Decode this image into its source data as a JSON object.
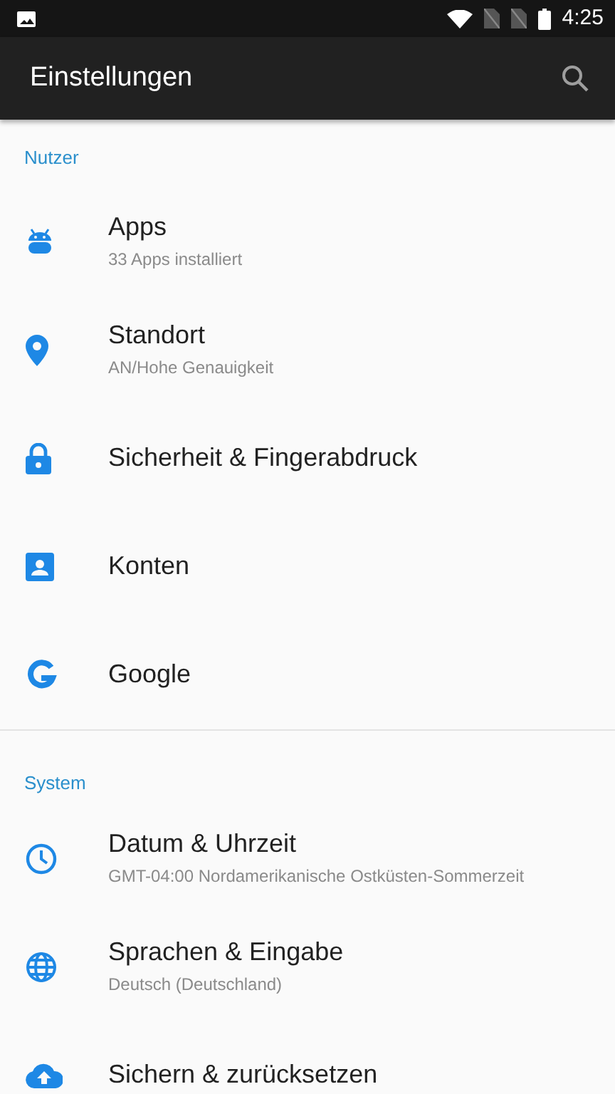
{
  "status_bar": {
    "time": "4:25"
  },
  "app_bar": {
    "title": "Einstellungen"
  },
  "sections": [
    {
      "title": "Nutzer",
      "items": [
        {
          "title": "Apps",
          "subtitle": "33 Apps installiert"
        },
        {
          "title": "Standort",
          "subtitle": "AN/Hohe Genauigkeit"
        },
        {
          "title": "Sicherheit & Fingerabdruck"
        },
        {
          "title": "Konten"
        },
        {
          "title": "Google"
        }
      ]
    },
    {
      "title": "System",
      "items": [
        {
          "title": "Datum & Uhrzeit",
          "subtitle": "GMT-04:00 Nordamerikanische Ostküsten-Sommerzeit"
        },
        {
          "title": "Sprachen & Eingabe",
          "subtitle": "Deutsch (Deutschland)"
        },
        {
          "title": "Sichern & zurücksetzen"
        }
      ]
    }
  ]
}
